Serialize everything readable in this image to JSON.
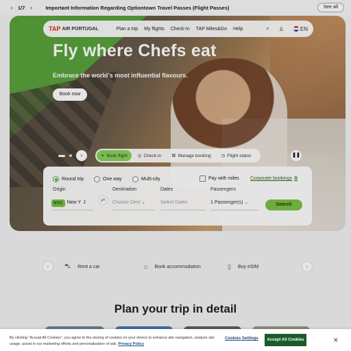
{
  "announcement": {
    "counter": "1/7",
    "message": "Important Information Regarding Optiontown Travel Passes (Flight Passes)",
    "see_all": "See all"
  },
  "nav": {
    "logo_mark": "TAP",
    "logo_text": "AIR PORTUGAL",
    "links": [
      "Plan a trip",
      "My flights",
      "Check-In",
      "TAP Miles&Go",
      "Help"
    ],
    "language": "EN"
  },
  "hero": {
    "title": "Fly where Chefs eat",
    "subtitle": "Embrace the world’s most influential flavours.",
    "cta": "Book now"
  },
  "tabs": [
    "Book flight",
    "Check-in",
    "Manage booking",
    "Flight status"
  ],
  "booking": {
    "trip_types": [
      "Round trip",
      "One way",
      "Multi-city"
    ],
    "selected_trip": "Round trip",
    "pay_with_miles": "Pay with miles",
    "corporate": "Corporate bookings",
    "labels": {
      "origin": "Origin",
      "destination": "Destination",
      "dates": "Dates",
      "passengers": "Passengers"
    },
    "origin_code": "NYC",
    "origin_value": "New Y",
    "destination_placeholder": "Choose Dest",
    "dates_placeholder": "Select Dates",
    "passengers_value": "1 Passenger(s)",
    "search": "Search"
  },
  "quick_links": [
    "Rent a car",
    "Book accommodation",
    "Buy eSIM"
  ],
  "section_title": "Plan your trip in detail",
  "cookie": {
    "text": "By clicking “Accept All Cookies”, you agree to the storing of cookies on your device to enhance site navigation, analyze site usage, assist in our marketing efforts and personalization of ads.",
    "policy": "Privacy Policy",
    "settings": "Cookies Settings",
    "accept": "Accept All Cookies"
  },
  "colors": {
    "brand_green": "#7cc046",
    "brand_red": "#e1261c",
    "accept_bg": "#1a5a2a"
  }
}
